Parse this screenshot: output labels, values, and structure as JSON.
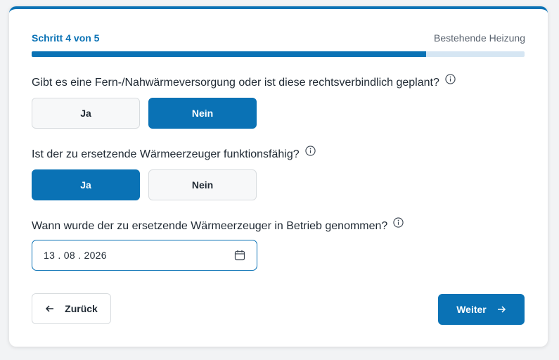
{
  "header": {
    "step_label": "Schritt 4 von 5",
    "step_name": "Bestehende Heizung"
  },
  "progress": {
    "fraction": 0.8
  },
  "questions": [
    {
      "text": "Gibt es eine Fern-/Nahwärmeversorgung oder ist diese rechtsverbindlich geplant?",
      "options": [
        "Ja",
        "Nein"
      ],
      "selected": "Nein"
    },
    {
      "text": "Ist der zu ersetzende Wärmeerzeuger funktionsfähig?",
      "options": [
        "Ja",
        "Nein"
      ],
      "selected": "Ja"
    },
    {
      "text": "Wann wurde der zu ersetzende Wärmeerzeuger in Betrieb genommen?",
      "date_value": "13 . 08 . 2026"
    }
  ],
  "nav": {
    "back_label": "Zurück",
    "next_label": "Weiter"
  },
  "icons": {
    "info": "info-circle-icon",
    "calendar": "calendar-icon",
    "back": "arrow-left-icon",
    "next": "arrow-right-icon"
  },
  "colors": {
    "primary": "#0a72b5",
    "progress_track": "#d6e6f3",
    "unselected_bg": "#f7f8f9"
  }
}
